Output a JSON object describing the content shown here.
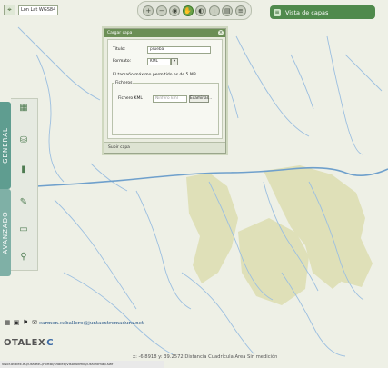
{
  "coord_box": {
    "value": "Lon Lat WGS84"
  },
  "toolbar": {
    "buttons": [
      {
        "icon": "zoom-in-icon",
        "glyph": "+"
      },
      {
        "icon": "zoom-out-icon",
        "glyph": "−"
      },
      {
        "icon": "globe-icon",
        "glyph": "◉"
      },
      {
        "icon": "pan-icon",
        "glyph": "✋"
      },
      {
        "icon": "measure-icon",
        "glyph": "◐"
      },
      {
        "icon": "info-icon",
        "glyph": "i"
      },
      {
        "icon": "print-icon",
        "glyph": "▤"
      },
      {
        "icon": "layers-icon",
        "glyph": "≡"
      }
    ]
  },
  "capas": {
    "title": "Vista de capas",
    "icon": "layers-icon"
  },
  "sidebar": {
    "general_label": "GENERAL",
    "avanzado_label": "AVANZADO",
    "icons": [
      "stack-icon",
      "cylinder-icon",
      "bar-chart-icon",
      "pencil-icon",
      "ruler-icon",
      "pin-icon"
    ]
  },
  "dialog": {
    "title": "Cargar capa",
    "titulo_label": "Título:",
    "titulo_value": "prueba",
    "formato_label": "Formato:",
    "formato_value": "KML",
    "size_note": "El tamaño máximo permitido es de 5 MB",
    "fieldset_label": "Ficheros",
    "fichero_label": "Fichero KML",
    "fichero_placeholder": "Ninfero kml",
    "examinar_label": "Examinar...",
    "footer": "Subir capa"
  },
  "footer": {
    "email": "carmen.caballero@juntaextremadura.net",
    "brand_main": "OTALEX",
    "brand_mid": "C",
    "coords": "x: -6.8918   y: 39.2572   Distancia   Cuadrícula   Area   Sin medición",
    "status_url": "visor.otalex.eu/OtalexC/Portal/Otalex/VisorAdmin/Otalexmap.swf"
  },
  "colors": {
    "map_bg": "#eef0e6",
    "river": "#9cbfe0",
    "river_main": "#6fa0cc",
    "terrain": "#dfe0b8",
    "green": "#4f8a4c",
    "teal": "#5f9d90"
  }
}
